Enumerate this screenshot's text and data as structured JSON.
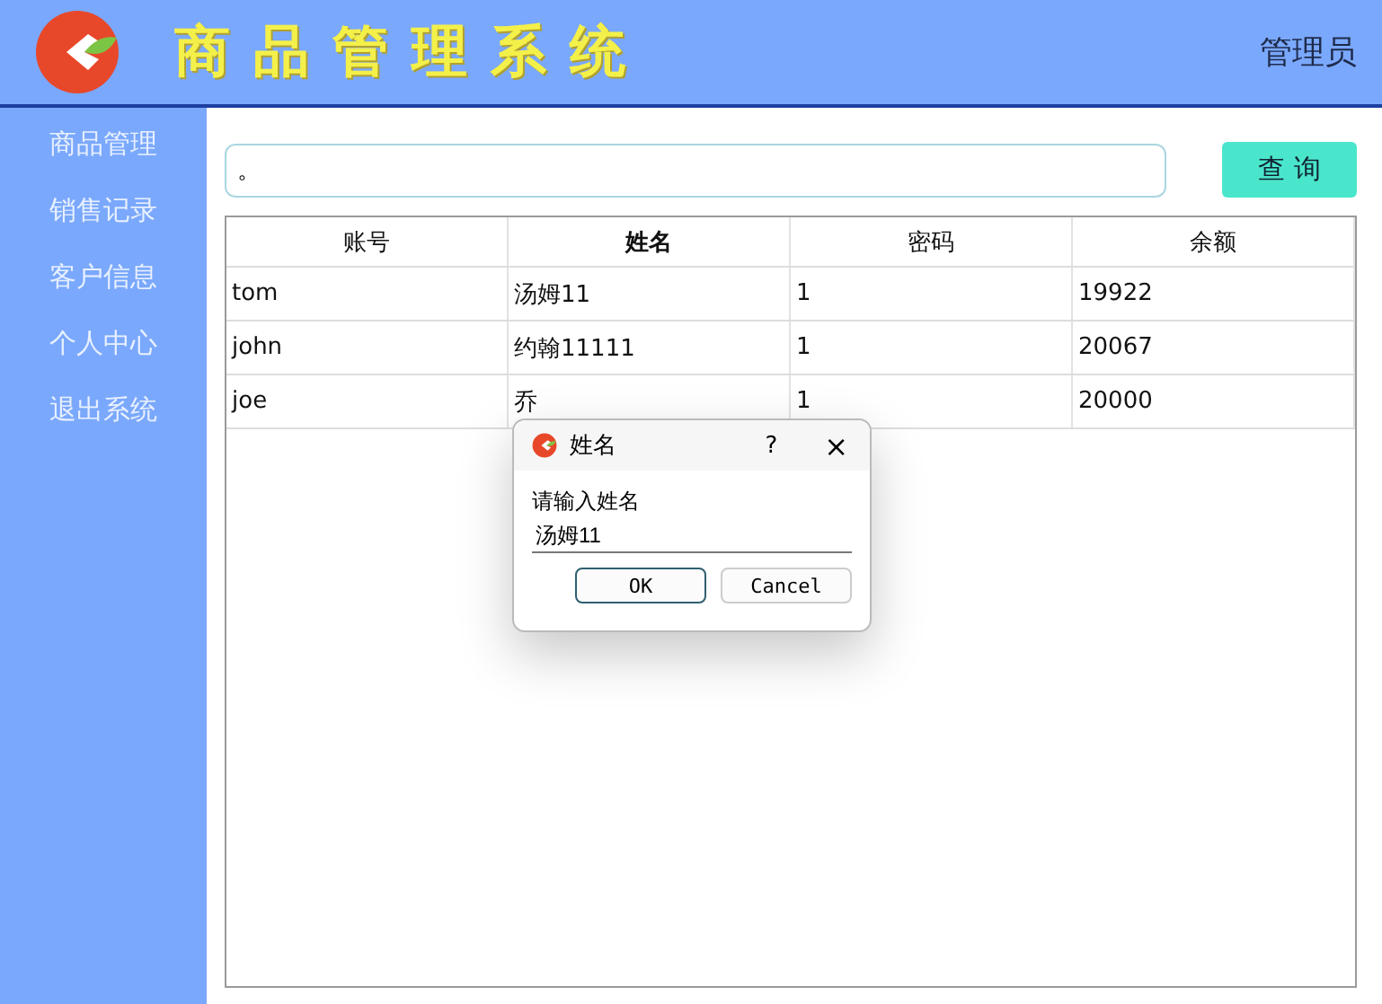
{
  "header": {
    "title": "商品管理系统",
    "user": "管理员"
  },
  "sidebar": {
    "items": [
      {
        "label": "商品管理"
      },
      {
        "label": "销售记录"
      },
      {
        "label": "客户信息"
      },
      {
        "label": "个人中心"
      },
      {
        "label": "退出系统"
      }
    ]
  },
  "search": {
    "value": "。",
    "button": "查 询"
  },
  "table": {
    "columns": [
      {
        "label": "账号",
        "bold": false
      },
      {
        "label": "姓名",
        "bold": true
      },
      {
        "label": "密码",
        "bold": false
      },
      {
        "label": "余额",
        "bold": false
      }
    ],
    "rows": [
      [
        "tom",
        "汤姆11",
        "1",
        "19922"
      ],
      [
        "john",
        "约翰11111",
        "1",
        "20067"
      ],
      [
        "joe",
        "乔",
        "1",
        "20000"
      ]
    ]
  },
  "dialog": {
    "title": "姓名",
    "help": "?",
    "close": "×",
    "prompt": "请输入姓名",
    "value": "汤姆11",
    "buttons": [
      {
        "label": "OK",
        "focused": true
      },
      {
        "label": "Cancel",
        "focused": false
      }
    ]
  }
}
